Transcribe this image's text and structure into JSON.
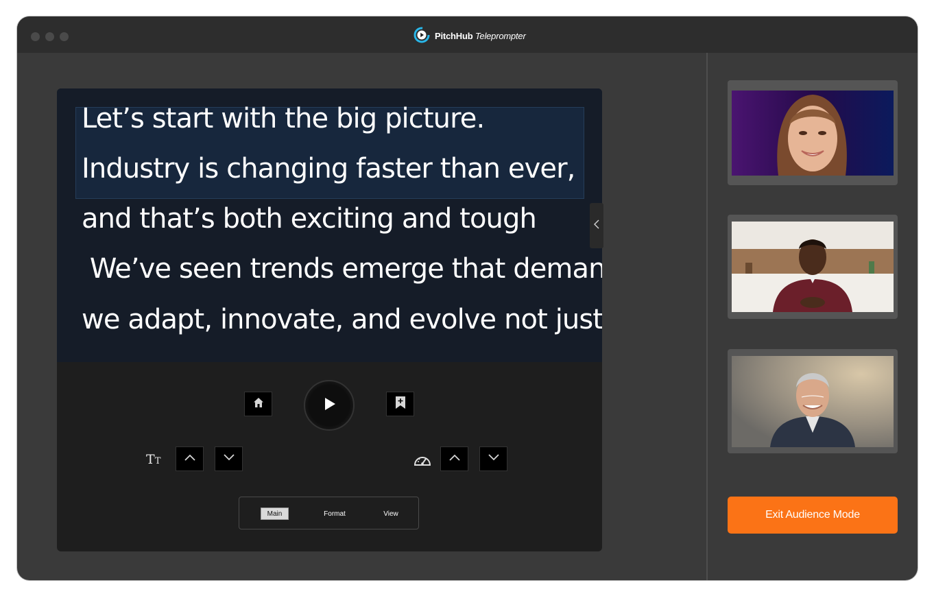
{
  "window": {
    "brand_strong": "PitchHub",
    "brand_italic": "Teleprompter",
    "logo_icon": "play-circle-icon",
    "accent_color": "#fb7316",
    "logo_color": "#29b6e8"
  },
  "script": {
    "lines": [
      "Let’s start with the big picture.",
      "Industry is changing faster than ever,",
      "and that’s both exciting and tough",
      " We’ve seen trends emerge that demand",
      "we adapt, innovate, and evolve not just"
    ]
  },
  "controls": {
    "home_icon": "home-icon",
    "play_icon": "play-icon",
    "bookmark_icon": "bookmark-add-icon",
    "text_size_label_big": "T",
    "text_size_label_small": "T",
    "speed_icon": "speedometer-icon",
    "up_icon": "chevron-up-icon",
    "down_icon": "chevron-down-icon",
    "collapse_icon": "chevron-left-icon"
  },
  "tabs": [
    {
      "label": "Main",
      "active": true
    },
    {
      "label": "Format",
      "active": false
    },
    {
      "label": "View",
      "active": false
    }
  ],
  "participants": [
    {
      "name": "participant-1"
    },
    {
      "name": "participant-2"
    },
    {
      "name": "participant-3"
    }
  ],
  "exit_button": "Exit Audience Mode"
}
